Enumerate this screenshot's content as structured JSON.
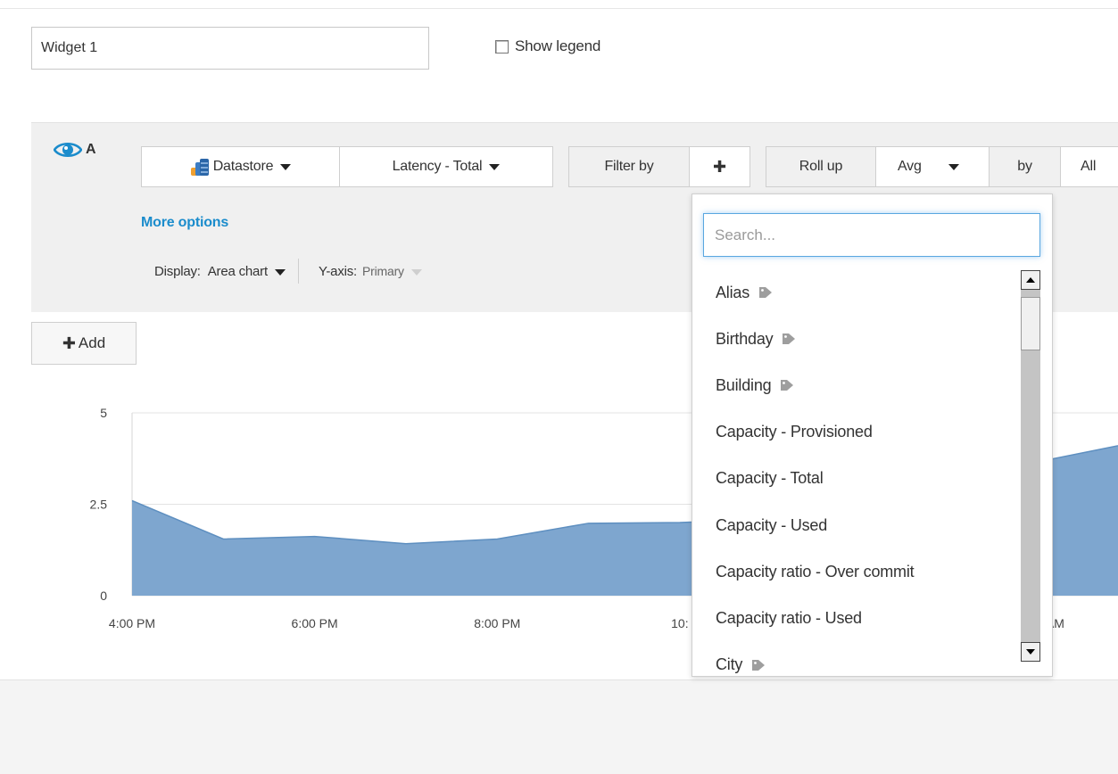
{
  "widget": {
    "name_value": "Widget 1",
    "show_legend_label": "Show legend",
    "show_legend_checked": false
  },
  "query": {
    "series_letter": "A",
    "object_type": "Datastore",
    "metric": "Latency - Total",
    "filter_label": "Filter by",
    "filter_add": "✚",
    "rollup_label": "Roll up",
    "rollup_value": "Avg",
    "by_label": "by",
    "by_value": "All",
    "more_options": "More options",
    "display_label": "Display:",
    "display_value": "Area chart",
    "yaxis_label": "Y-axis:",
    "yaxis_value": "Primary"
  },
  "add_button": {
    "icon": "✚",
    "label": "Add"
  },
  "dropdown": {
    "search_placeholder": "Search...",
    "options": [
      {
        "label": "Alias",
        "tagged": true
      },
      {
        "label": "Birthday",
        "tagged": true
      },
      {
        "label": "Building",
        "tagged": true
      },
      {
        "label": "Capacity - Provisioned",
        "tagged": false
      },
      {
        "label": "Capacity - Total",
        "tagged": false
      },
      {
        "label": "Capacity - Used",
        "tagged": false
      },
      {
        "label": "Capacity ratio - Over commit",
        "tagged": false
      },
      {
        "label": "Capacity ratio - Used",
        "tagged": false
      },
      {
        "label": "City",
        "tagged": true
      }
    ]
  },
  "colors": {
    "accent": "#1b8ccc",
    "area_fill": "#7ea6cf",
    "area_stroke": "#5e8fc0",
    "tag": "#9e9e9e"
  },
  "chart_data": {
    "type": "area",
    "y_ticks": [
      "5",
      "2.5",
      "0"
    ],
    "ylim": [
      0,
      5
    ],
    "x_tick_labels": [
      "4:00 PM",
      "6:00 PM",
      "8:00 PM",
      "10:",
      ":00 AM"
    ],
    "x_tick_hours": [
      16,
      18,
      20,
      22,
      26
    ],
    "xlim": [
      16,
      26.8
    ],
    "series": [
      {
        "x": [
          16,
          17,
          18,
          19,
          20,
          21,
          22,
          23,
          24,
          25,
          25.5,
          26,
          26.8
        ],
        "values": [
          2.6,
          1.55,
          1.62,
          1.42,
          1.55,
          1.98,
          2.0,
          2.1,
          2.2,
          2.4,
          3.1,
          3.7,
          4.1
        ]
      }
    ]
  }
}
